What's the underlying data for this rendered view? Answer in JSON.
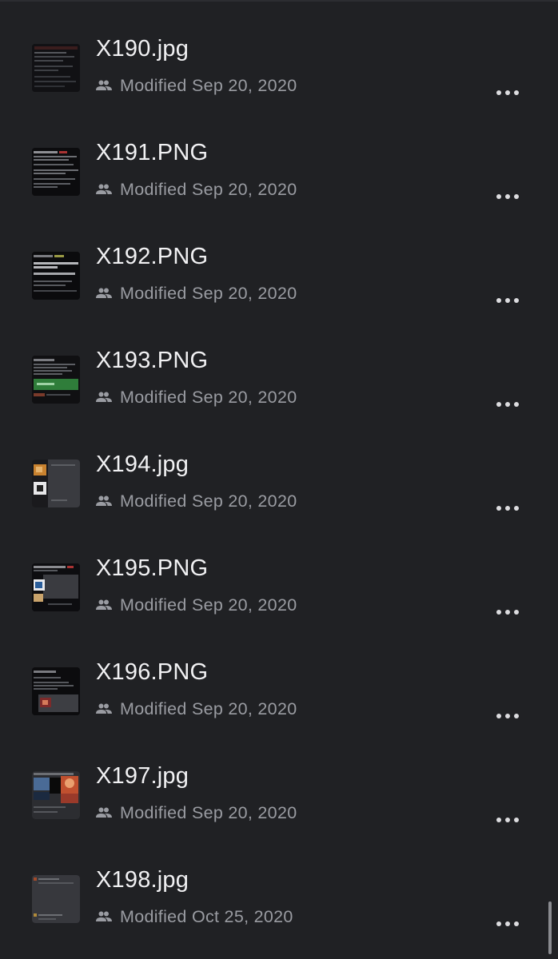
{
  "files": [
    {
      "name": "X190.jpg",
      "modified": "Modified Sep 20, 2020",
      "thumbnail_style": "dark-document"
    },
    {
      "name": "X191.PNG",
      "modified": "Modified Sep 20, 2020",
      "thumbnail_style": "dark-text"
    },
    {
      "name": "X192.PNG",
      "modified": "Modified Sep 20, 2020",
      "thumbnail_style": "dark-text-bold"
    },
    {
      "name": "X193.PNG",
      "modified": "Modified Sep 20, 2020",
      "thumbnail_style": "green-banner"
    },
    {
      "name": "X194.jpg",
      "modified": "Modified Sep 20, 2020",
      "thumbnail_style": "gray-photos"
    },
    {
      "name": "X195.PNG",
      "modified": "Modified Sep 20, 2020",
      "thumbnail_style": "dark-photo-blue"
    },
    {
      "name": "X196.PNG",
      "modified": "Modified Sep 20, 2020",
      "thumbnail_style": "dark-photo-red"
    },
    {
      "name": "X197.jpg",
      "modified": "Modified Sep 20, 2020",
      "thumbnail_style": "colorful-photos"
    },
    {
      "name": "X198.jpg",
      "modified": "Modified Oct 25, 2020",
      "thumbnail_style": "gray-plain"
    }
  ],
  "icons": {
    "shared": "people-icon",
    "more": "more-horizontal-icon"
  },
  "colors": {
    "background": "#202124",
    "file_name": "#f1f1f3",
    "meta_text": "#9a9ca2",
    "more_dots": "#dcdcdf",
    "scrollbar": "#8a8b90"
  }
}
